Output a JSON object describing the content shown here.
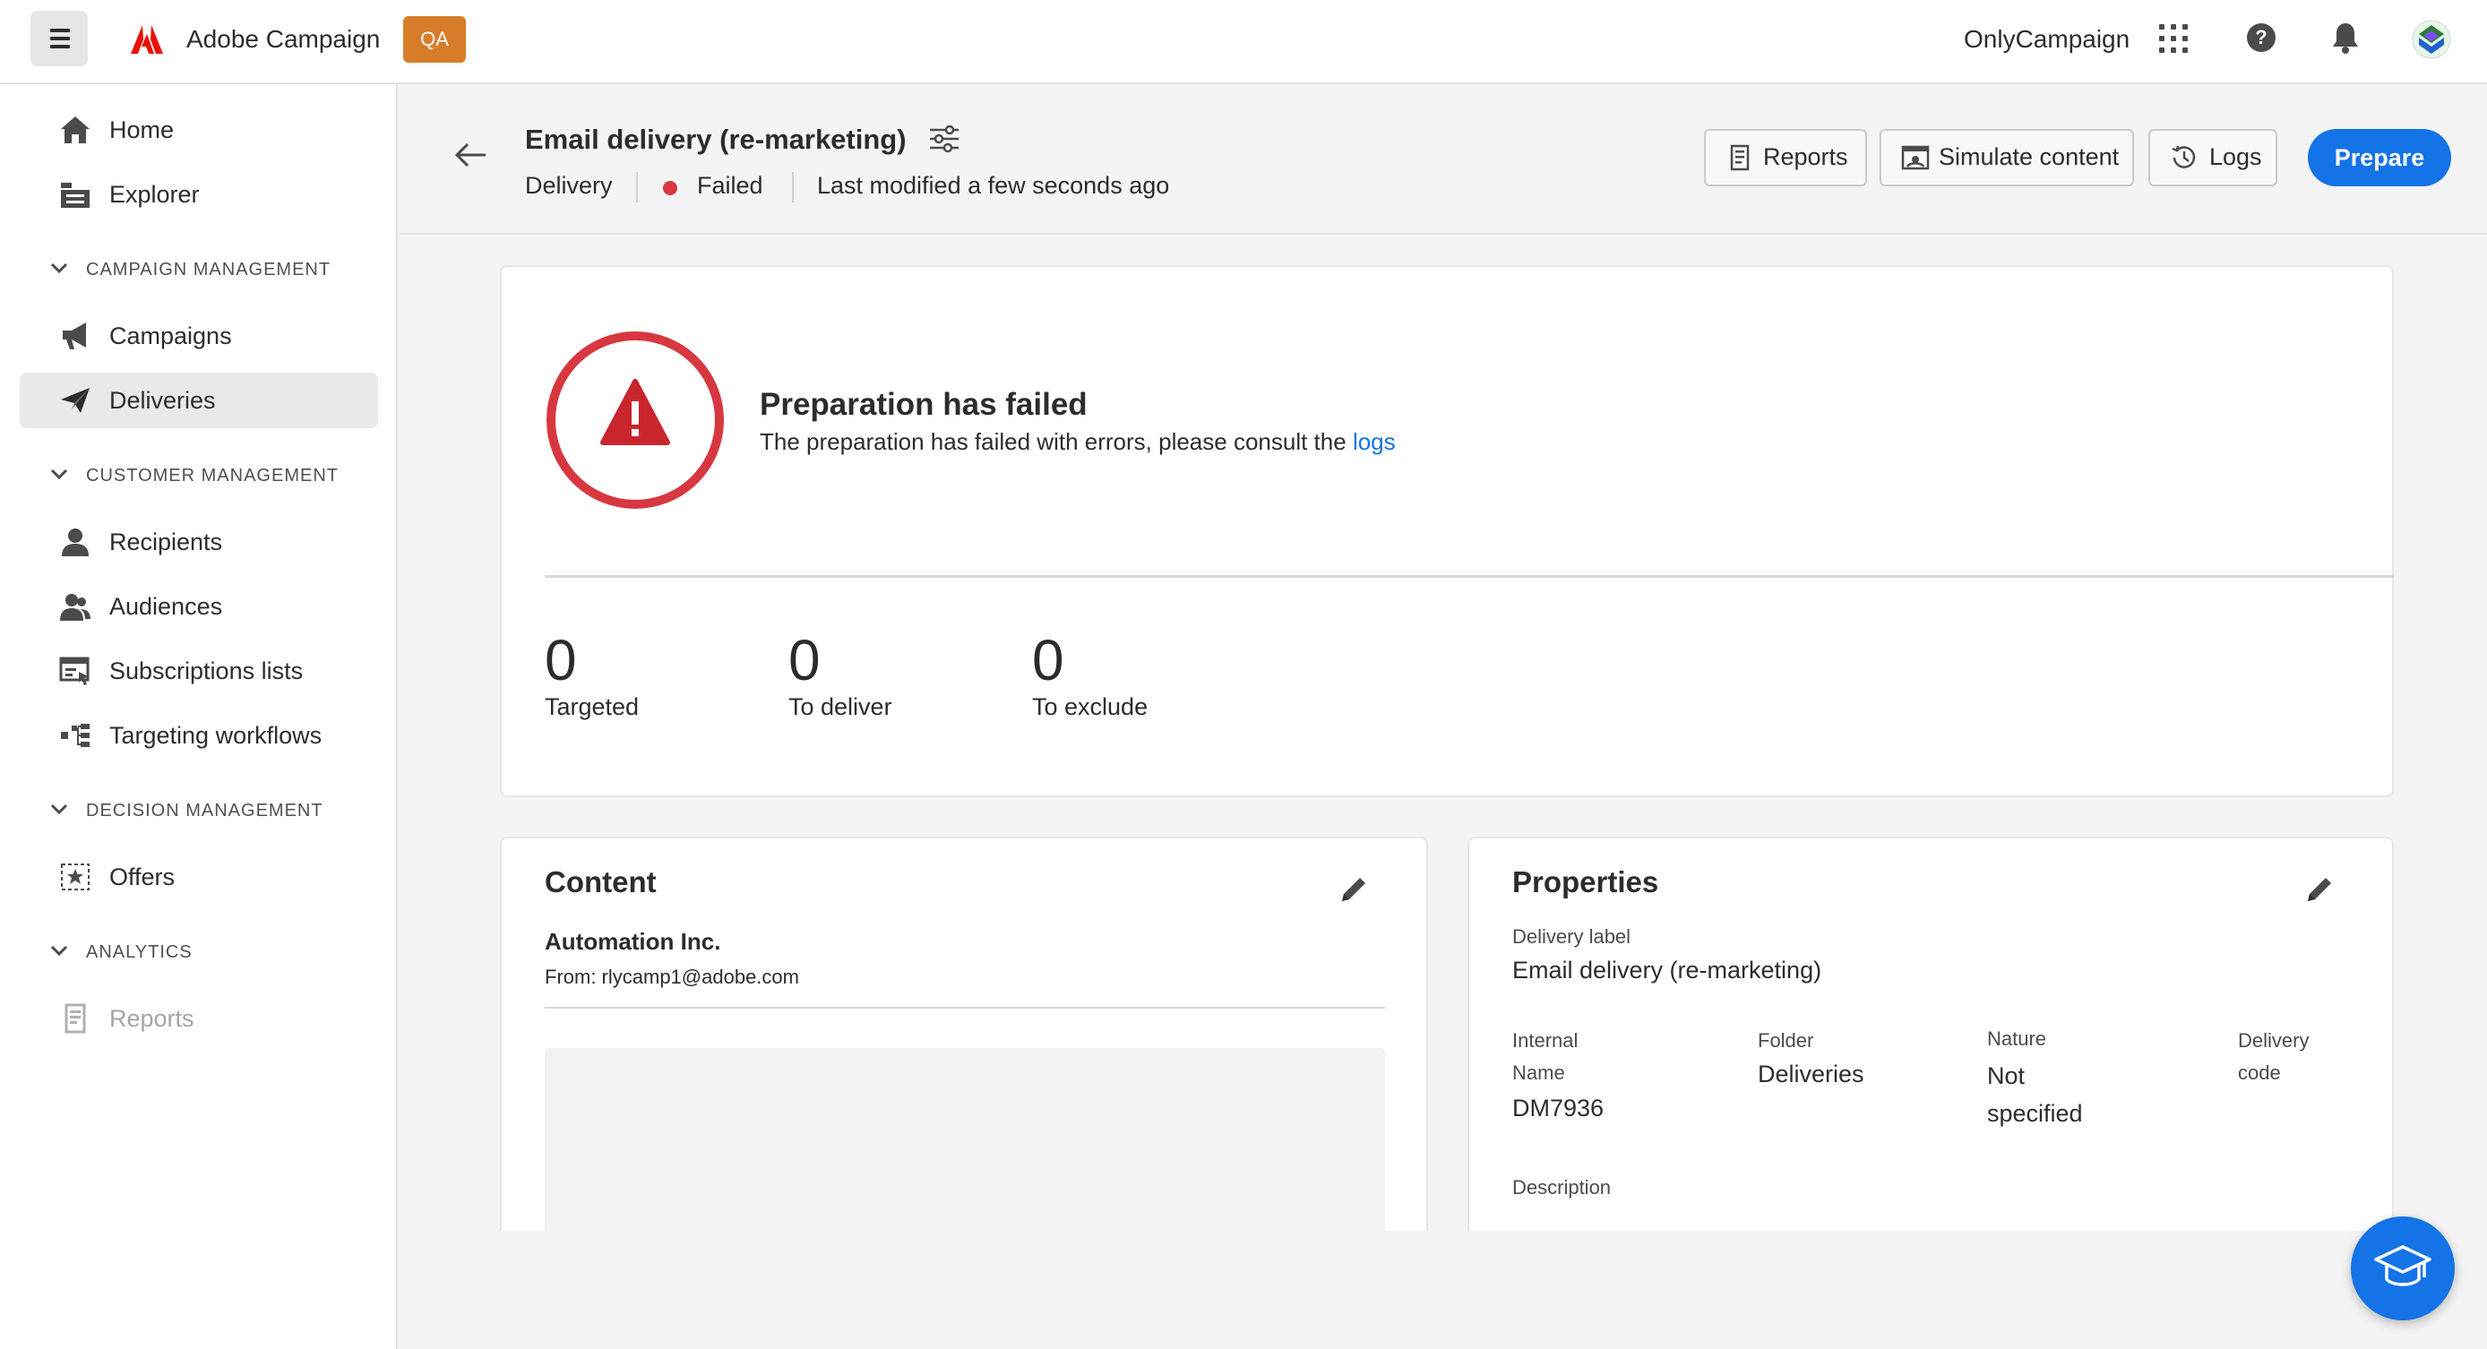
{
  "topbar": {
    "app_name": "Adobe Campaign",
    "env_badge": "QA",
    "org_name": "OnlyCampaign",
    "help_glyph": "?"
  },
  "sidebar": {
    "items": [
      {
        "label": "Home",
        "icon": "home-icon"
      },
      {
        "label": "Explorer",
        "icon": "explorer-icon"
      },
      {
        "label": "Campaigns",
        "icon": "megaphone-icon"
      },
      {
        "label": "Deliveries",
        "icon": "send-icon",
        "active": true
      },
      {
        "label": "Recipients",
        "icon": "user-icon"
      },
      {
        "label": "Audiences",
        "icon": "users-icon"
      },
      {
        "label": "Subscriptions lists",
        "icon": "subscription-list-icon"
      },
      {
        "label": "Targeting workflows",
        "icon": "workflow-icon"
      },
      {
        "label": "Offers",
        "icon": "offer-star-icon"
      },
      {
        "label": "Reports",
        "icon": "report-icon",
        "disabled": true
      }
    ],
    "sections": [
      {
        "label": "CAMPAIGN MANAGEMENT"
      },
      {
        "label": "CUSTOMER MANAGEMENT"
      },
      {
        "label": "DECISION MANAGEMENT"
      },
      {
        "label": "ANALYTICS"
      }
    ]
  },
  "header": {
    "title": "Email delivery (re-marketing)",
    "type": "Delivery",
    "status": "Failed",
    "status_color": "#d7373f",
    "modified": "Last modified a few seconds ago",
    "buttons": {
      "reports": "Reports",
      "simulate": "Simulate content",
      "logs": "Logs",
      "prepare": "Prepare"
    }
  },
  "status_card": {
    "title": "Preparation has failed",
    "message": "The preparation has failed with errors, please consult the",
    "link": "logs",
    "stats": [
      {
        "value": "0",
        "label": "Targeted"
      },
      {
        "value": "0",
        "label": "To deliver"
      },
      {
        "value": "0",
        "label": "To exclude"
      }
    ]
  },
  "content_card": {
    "title": "Content",
    "sender": "Automation Inc.",
    "from": "From: rlycamp1@adobe.com"
  },
  "properties_card": {
    "title": "Properties",
    "delivery_label_key": "Delivery label",
    "delivery_label_value": "Email delivery (re-marketing)",
    "internal_name_key_1": "Internal",
    "internal_name_key_2": "Name",
    "internal_name_value": "DM7936",
    "folder_key": "Folder",
    "folder_value": "Deliveries",
    "nature_key": "Nature",
    "nature_value_1": "Not",
    "nature_value_2": "specified",
    "delivery_code_key_1": "Delivery",
    "delivery_code_key_2": "code",
    "description_key": "Description"
  },
  "colors": {
    "accent": "#1473e6",
    "error": "#d7373f",
    "env_badge": "#d77d2a"
  }
}
